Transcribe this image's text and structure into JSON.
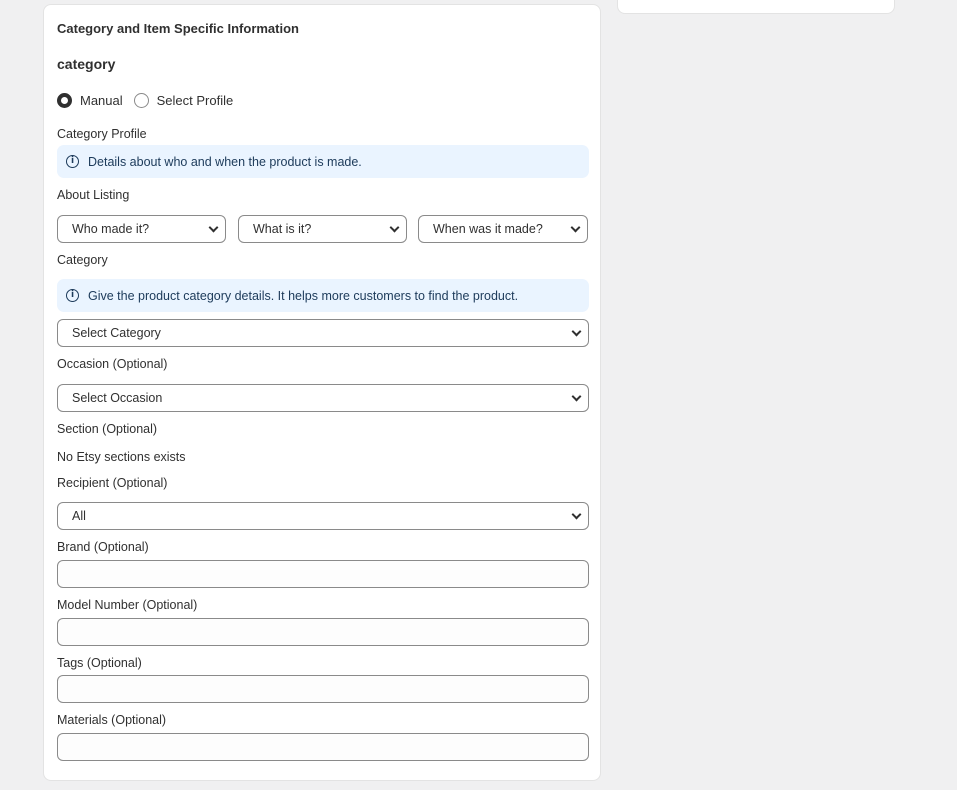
{
  "card": {
    "title": "Category and Item Specific Information",
    "section_heading": "category"
  },
  "category_mode": {
    "options": [
      {
        "label": "Manual",
        "selected": true
      },
      {
        "label": "Select Profile",
        "selected": false
      }
    ]
  },
  "category_profile": {
    "label": "Category Profile",
    "banner": "Details about who and when the product is made."
  },
  "about_listing": {
    "label": "About Listing",
    "who_made": "Who made it?",
    "what_is": "What is it?",
    "when_made": "When was it made?"
  },
  "category": {
    "label": "Category",
    "banner": "Give the product category details. It helps more customers to find the product.",
    "select_value": "Select Category"
  },
  "occasion": {
    "label": "Occasion (Optional)",
    "select_value": "Select Occasion"
  },
  "section": {
    "label": "Section (Optional)",
    "empty_text": "No Etsy sections exists"
  },
  "recipient": {
    "label": "Recipient (Optional)",
    "select_value": "All"
  },
  "brand": {
    "label": "Brand (Optional)",
    "value": ""
  },
  "model_number": {
    "label": "Model Number (Optional)",
    "value": ""
  },
  "tags": {
    "label": "Tags (Optional)",
    "value": ""
  },
  "materials": {
    "label": "Materials (Optional)",
    "value": ""
  },
  "colors": {
    "banner_bg": "#eaf4ff",
    "banner_text": "#1c3a5a",
    "page_bg": "#f0f0f1"
  },
  "icons": {
    "info": "info-circle-icon",
    "dropdown": "chevron-down-icon"
  }
}
